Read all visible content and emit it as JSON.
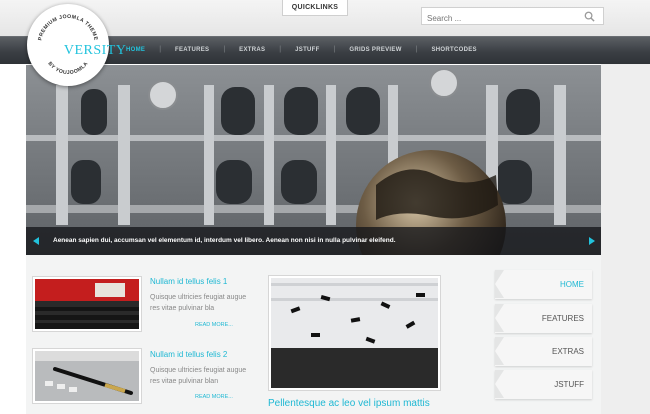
{
  "top": {
    "quicklinks_label": "QUICKLINKS",
    "search_placeholder": "Search ..."
  },
  "brand": {
    "logo_part1": "YOU",
    "logo_part2": "VERSITY",
    "badge_top": "PREMIUM JOOMLA THEME",
    "badge_bottom": "BY YOUJOOMLA"
  },
  "nav": {
    "items": [
      {
        "label": "HOME",
        "active": true
      },
      {
        "label": "FEATURES",
        "active": false
      },
      {
        "label": "EXTRAS",
        "active": false
      },
      {
        "label": "JSTUFF",
        "active": false
      },
      {
        "label": "GRIDS PREVIEW",
        "active": false
      },
      {
        "label": "SHORTCODES",
        "active": false
      }
    ]
  },
  "slider": {
    "caption": "Aenean sapien dui, accumsan vel elementum id, interdum vel libero. Aenean non nisi in nulla pulvinar eleifend."
  },
  "articles": [
    {
      "title": "Nullam id tellus felis 1",
      "text1": "Quisque ultricies feugiat augue",
      "text2": "res vitae pulvinar bla",
      "readmore": "READ MORE..."
    },
    {
      "title": "Nullam id tellus felis 2",
      "text1": "Quisque ultricies feugiat augue",
      "text2": "res vitae pulvinar blan",
      "readmore": "READ MORE..."
    }
  ],
  "feature": {
    "title": "Pellentesque ac leo vel ipsum mattis"
  },
  "side_tabs": [
    {
      "label": "HOME",
      "active": true
    },
    {
      "label": "FEATURES",
      "active": false
    },
    {
      "label": "EXTRAS",
      "active": false
    },
    {
      "label": "JSTUFF",
      "active": false
    }
  ],
  "colors": {
    "accent": "#22c3dd",
    "navbar": "#3b3f44"
  }
}
